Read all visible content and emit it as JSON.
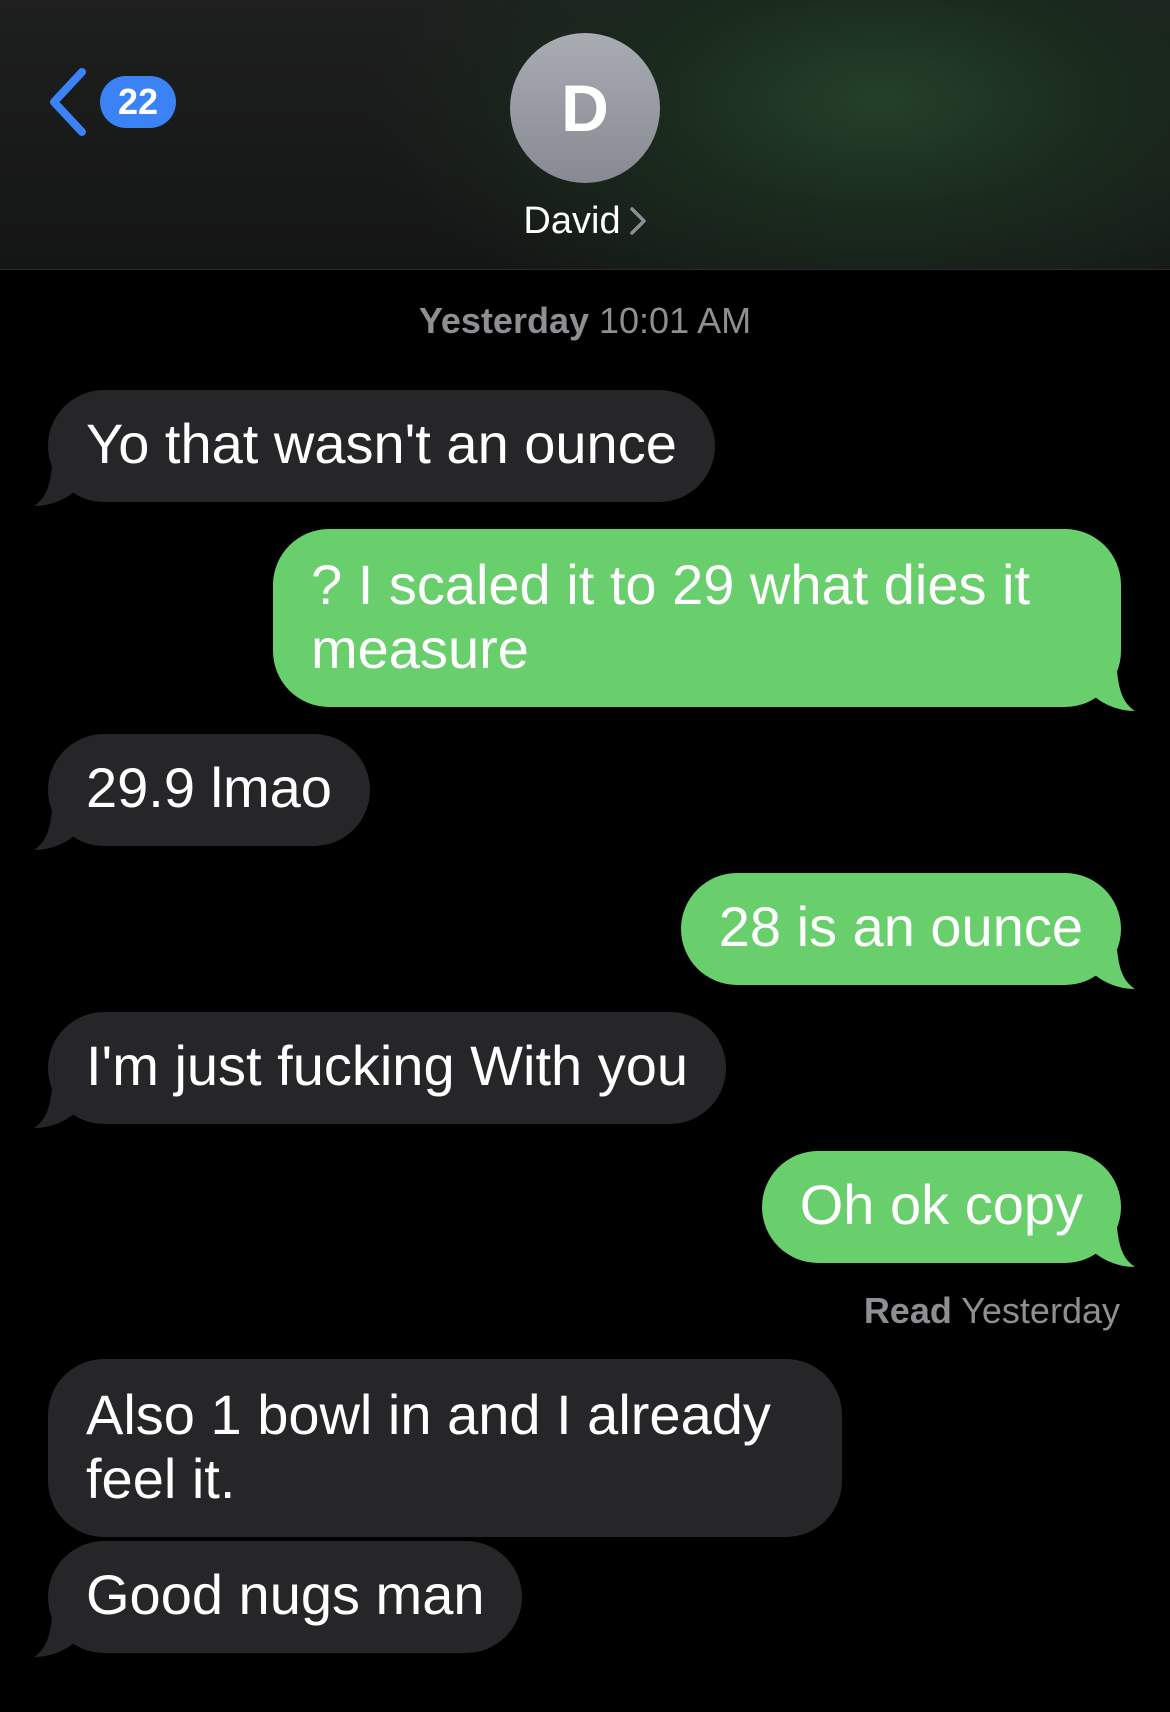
{
  "header": {
    "back_count": "22",
    "avatar_initial": "D",
    "contact_name": "David"
  },
  "conversation": {
    "timestamp_day": "Yesterday",
    "timestamp_time": "10:01 AM",
    "messages": [
      {
        "from": "them",
        "text": "Yo that wasn't an ounce"
      },
      {
        "from": "me",
        "text": "? I scaled it to 29 what dies it measure"
      },
      {
        "from": "them",
        "text": "29.9 lmao"
      },
      {
        "from": "me",
        "text": "28 is an ounce"
      },
      {
        "from": "them",
        "text": "I'm just fucking With you"
      },
      {
        "from": "me",
        "text": "Oh ok copy"
      },
      {
        "from": "them",
        "text": "Also 1 bowl in and I already feel it."
      },
      {
        "from": "them",
        "text": "Good nugs man"
      }
    ],
    "read_label": "Read",
    "read_time": "Yesterday"
  },
  "colors": {
    "incoming_bubble": "#262628",
    "outgoing_bubble": "#68cf6c",
    "badge": "#3b82f6",
    "accent": "#3b82f6"
  },
  "icons": {
    "back": "chevron-left-icon",
    "contact_details": "chevron-right-icon"
  }
}
